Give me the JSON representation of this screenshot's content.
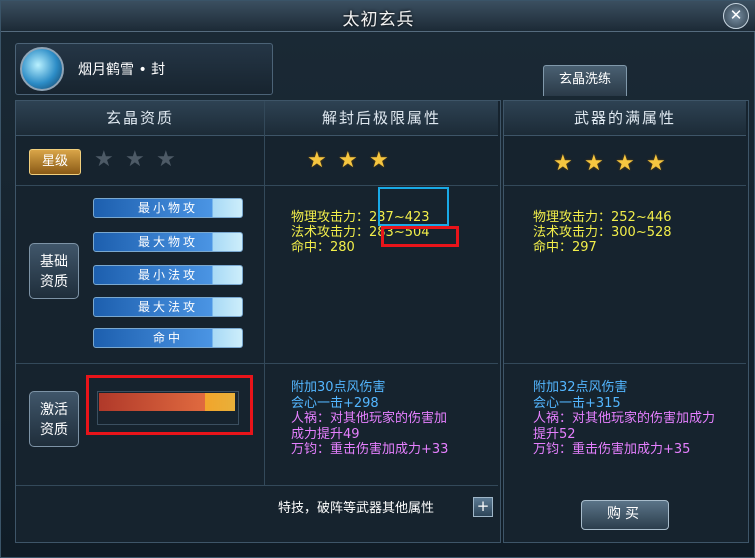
{
  "window": {
    "title": "太初玄兵",
    "close_symbol": "✕"
  },
  "item": {
    "name": "烟月鹤雪 • 封",
    "icon": "crystal-weapon-icon"
  },
  "tabs": [
    {
      "label": "玄晶洗练"
    }
  ],
  "columns": {
    "left": "玄晶资质",
    "middle": "解封后极限属性",
    "right": "武器的满属性"
  },
  "star_rank": {
    "label": "星级",
    "current_stars": 0,
    "current_max": 3,
    "unsealed_stars": 3,
    "full_stars": 4
  },
  "basic": {
    "label_line1": "基础",
    "label_line2": "资质",
    "bars": [
      {
        "label": "最小物攻",
        "fill": 0.8
      },
      {
        "label": "最大物攻",
        "fill": 0.8
      },
      {
        "label": "最小法攻",
        "fill": 0.8
      },
      {
        "label": "最大法攻",
        "fill": 0.8
      },
      {
        "label": "命中",
        "fill": 0.8
      }
    ],
    "unsealed_stats": [
      "物理攻击力：237~423",
      "法术攻击力：283~504",
      "命中：280"
    ],
    "full_stats": [
      "物理攻击力：252~446",
      "法术攻击力：300~528",
      "命中：297"
    ]
  },
  "activate": {
    "label_line1": "激活",
    "label_line2": "资质",
    "bar_fill": 0.78,
    "unsealed": {
      "wind": "附加30点风伤害",
      "crit": "会心一击+298",
      "pk_line1": "人祸：对其他玩家的伤害加",
      "pk_line2": "成力提升49",
      "heavy": "万钧：重击伤害加成力+33"
    },
    "full": {
      "wind": "附加32点风伤害",
      "crit": "会心一击+315",
      "pk_line1": "人祸：对其他玩家的伤害加成力",
      "pk_line2": "提升52",
      "heavy": "万钧：重击伤害加成力+35"
    }
  },
  "footer": {
    "other_attrs": "特技，破阵等武器其他属性",
    "plus": "+",
    "buy": "购买"
  },
  "colors": {
    "stat_yellow": "#f2ee4a",
    "stat_blue": "#53b6ff",
    "stat_purple": "#e680ff",
    "star_gold": "#f6c640",
    "highlight_cyan": "#19a9e6",
    "highlight_red": "#e8141a"
  }
}
